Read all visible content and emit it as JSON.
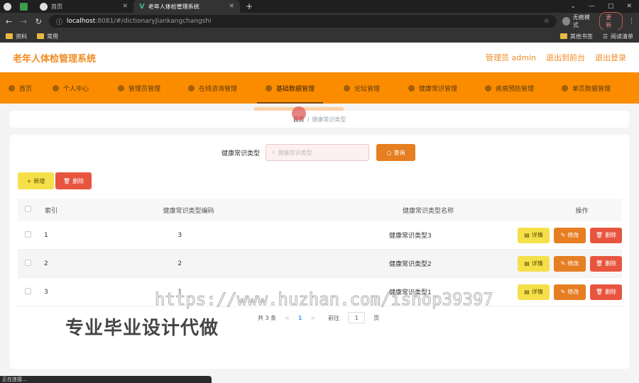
{
  "browser": {
    "tabs": [
      {
        "label": ""
      },
      {
        "label": ""
      },
      {
        "label": "首页"
      },
      {
        "label": "老年人体检管理系统"
      }
    ],
    "url_host": "localhost",
    "url_path": ":8081/#/dictionaryJiankangchangshi",
    "profile_label": "无痕模式",
    "update_label": "更新",
    "bookmarks": [
      "资料",
      "常用"
    ],
    "bookmarks_right": [
      "其他书签",
      "阅读清单"
    ],
    "status": "正在连接..."
  },
  "app": {
    "title": "老年人体检管理系统",
    "header_links": [
      "管理员 admin",
      "退出到前台",
      "退出登录"
    ]
  },
  "nav": {
    "items": [
      "首页",
      "个人中心",
      "管理员管理",
      "在线咨询管理",
      "基础数据管理",
      "论坛管理",
      "健康常识管理",
      "疾病预防管理",
      "单页数据管理"
    ],
    "active": "基础数据管理"
  },
  "breadcrumb": {
    "home": "首页",
    "sep": "/",
    "current": "健康常识类型"
  },
  "search": {
    "label": "健康常识类型",
    "placeholder": "健康常识类型",
    "button": "查询"
  },
  "actions": {
    "add": "新增",
    "delete": "删除"
  },
  "table": {
    "headers": [
      "索引",
      "健康常识类型编码",
      "健康常识类型名称",
      "操作"
    ],
    "rows": [
      {
        "index": "1",
        "code": "3",
        "name": "健康常识类型3"
      },
      {
        "index": "2",
        "code": "2",
        "name": "健康常识类型2"
      },
      {
        "index": "3",
        "code": "1",
        "name": "健康常识类型1"
      }
    ],
    "op_labels": {
      "detail": "详情",
      "edit": "修改",
      "remove": "删除"
    }
  },
  "pagination": {
    "total": "共 3 条",
    "prev": "<",
    "current_page": "1",
    "next": ">",
    "goto_label": "前往",
    "goto_value": "1",
    "page_suffix": "页"
  },
  "watermark": {
    "url": "https://www.huzhan.com/ishop39397",
    "text": "专业毕业设计代做"
  }
}
